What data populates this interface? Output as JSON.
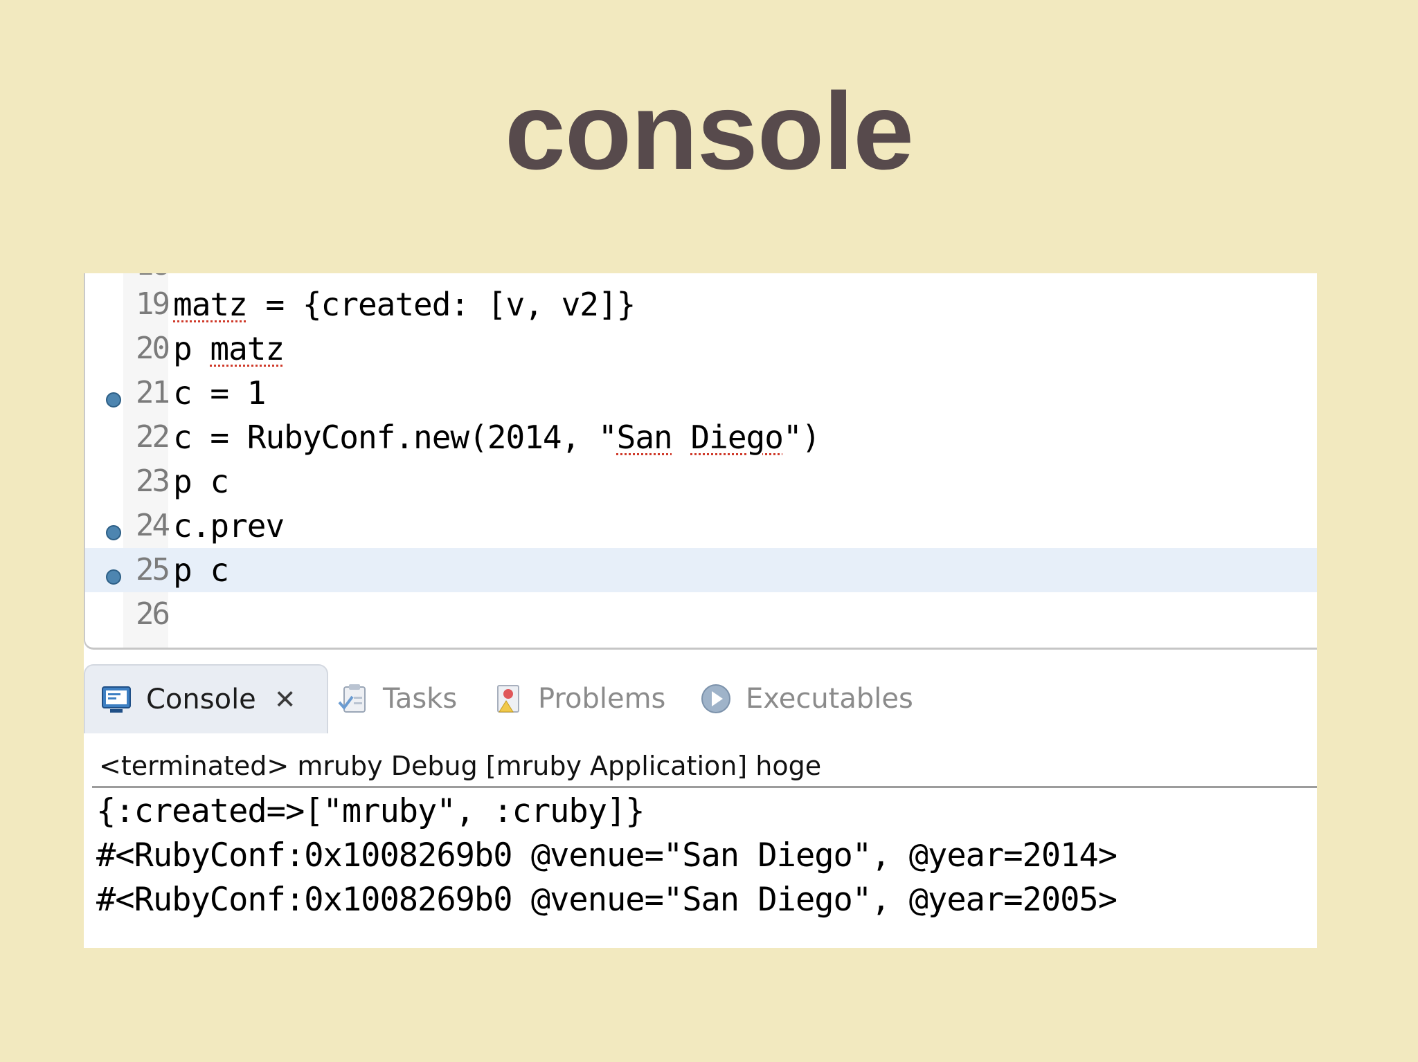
{
  "slide": {
    "title": "console"
  },
  "editor": {
    "partial_line_number": "18",
    "lines": [
      {
        "number": "19",
        "segments": [
          {
            "text": "matz",
            "squiggle": true
          },
          {
            "text": " = {created: [v, v2]}",
            "squiggle": false
          }
        ],
        "breakpoint": false,
        "current": false
      },
      {
        "number": "20",
        "segments": [
          {
            "text": "p ",
            "squiggle": false
          },
          {
            "text": "matz",
            "squiggle": true
          }
        ],
        "breakpoint": false,
        "current": false
      },
      {
        "number": "21",
        "segments": [
          {
            "text": "c = 1",
            "squiggle": false
          }
        ],
        "breakpoint": true,
        "current": false
      },
      {
        "number": "22",
        "segments": [
          {
            "text": "c = RubyConf.new(2014, \"",
            "squiggle": false
          },
          {
            "text": "San",
            "squiggle": true
          },
          {
            "text": " ",
            "squiggle": false
          },
          {
            "text": "Diego",
            "squiggle": true
          },
          {
            "text": "\")",
            "squiggle": false
          }
        ],
        "breakpoint": false,
        "current": false
      },
      {
        "number": "23",
        "segments": [
          {
            "text": "p c",
            "squiggle": false
          }
        ],
        "breakpoint": false,
        "current": false
      },
      {
        "number": "24",
        "segments": [
          {
            "text": "c.prev",
            "squiggle": false
          }
        ],
        "breakpoint": true,
        "current": false
      },
      {
        "number": "25",
        "segments": [
          {
            "text": "p c",
            "squiggle": false
          }
        ],
        "breakpoint": true,
        "current": true
      },
      {
        "number": "26",
        "segments": [
          {
            "text": "",
            "squiggle": false
          }
        ],
        "breakpoint": false,
        "current": false
      }
    ]
  },
  "tabs": [
    {
      "label": "Console",
      "icon": "console-icon",
      "active": true,
      "closable": true
    },
    {
      "label": "Tasks",
      "icon": "tasks-icon",
      "active": false,
      "closable": false
    },
    {
      "label": "Problems",
      "icon": "problems-icon",
      "active": false,
      "closable": false
    },
    {
      "label": "Executables",
      "icon": "executables-icon",
      "active": false,
      "closable": false
    }
  ],
  "console": {
    "status": "<terminated> mruby Debug [mruby Application] hoge",
    "output": [
      "{:created=>[\"mruby\", :cruby]}",
      "#<RubyConf:0x1008269b0 @venue=\"San Diego\", @year=2014>",
      "#<RubyConf:0x1008269b0 @venue=\"San Diego\", @year=2005>"
    ]
  },
  "colors": {
    "slide_background": "#f2e9bf",
    "title_color": "#574a4c",
    "breakpoint": "#4d85b0",
    "current_line": "#e7eff9",
    "squiggle": "#cf3a2a"
  }
}
